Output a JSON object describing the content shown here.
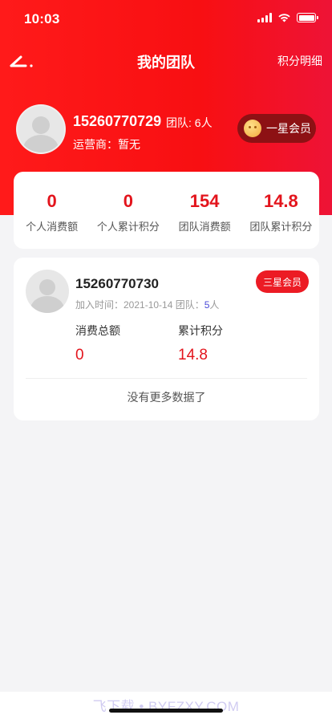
{
  "status_bar": {
    "time": "10:03"
  },
  "nav": {
    "title": "我的团队",
    "right_link": "积分明细"
  },
  "profile": {
    "phone": "15260770729",
    "team": "团队: 6人",
    "operator": "运营商：暂无",
    "level_badge": "一星会员"
  },
  "stats": [
    {
      "value": "0",
      "label": "个人消费额"
    },
    {
      "value": "0",
      "label": "个人累计积分"
    },
    {
      "value": "154",
      "label": "团队消费额"
    },
    {
      "value": "14.8",
      "label": "团队累计积分"
    }
  ],
  "members": [
    {
      "phone": "15260770730",
      "join_label": "加入时间：2021-10-14  团队：",
      "team_count": "5",
      "team_unit": "人",
      "level_badge": "三星会员",
      "spend_label": "消费总额",
      "spend_value": "0",
      "points_label": "累计积分",
      "points_value": "14.8"
    }
  ],
  "list_end_text": "没有更多数据了",
  "watermark": "飞下载 • BYFZXY.COM",
  "colors": {
    "primary_red": "#f80f12",
    "accent_red": "#e3141c",
    "badge_dark": "#8d1114"
  }
}
